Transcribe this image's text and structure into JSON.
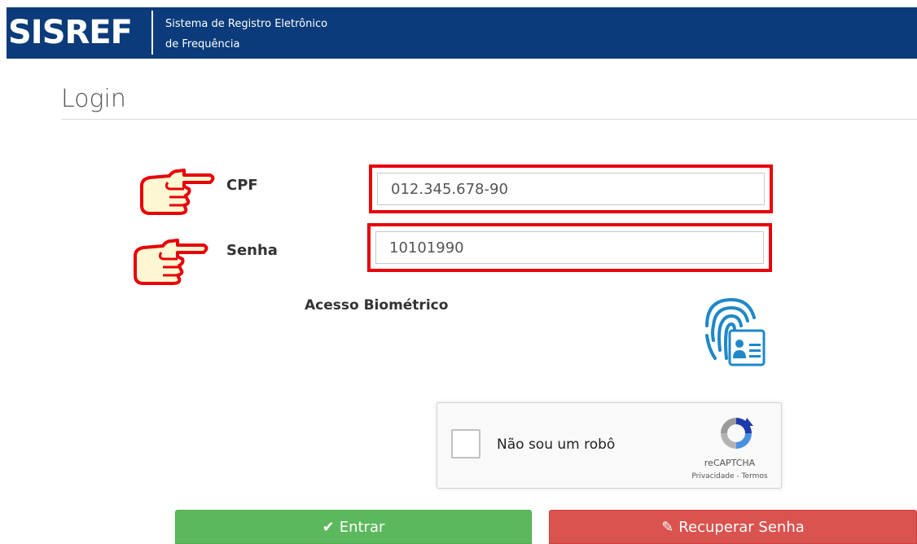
{
  "header": {
    "logo": "SISREF",
    "subtitle_line1": "Sistema de Registro Eletrônico",
    "subtitle_line2": "de Frequência",
    "background_color": "#0b3b7a"
  },
  "page": {
    "title": "Login"
  },
  "form": {
    "cpf_label": "CPF",
    "cpf_value": "012.345.678-90",
    "senha_label": "Senha",
    "senha_value": "10101990",
    "biometric_label": "Acesso Biométrico",
    "highlight_color": "#e8000b"
  },
  "recaptcha": {
    "text": "Não sou um robô",
    "brand": "reCAPTCHA",
    "links": "Privacidade - Termos"
  },
  "buttons": {
    "enter_icon": "✔",
    "enter_label": "Entrar",
    "recover_icon": "✎",
    "recover_label": "Recuperar Senha",
    "enter_color": "#5cb85c",
    "recover_color": "#d9534f"
  },
  "icons": {
    "pointer": "pointing-hand-icon",
    "biometric": "fingerprint-icon",
    "recaptcha": "recaptcha-logo-icon"
  }
}
